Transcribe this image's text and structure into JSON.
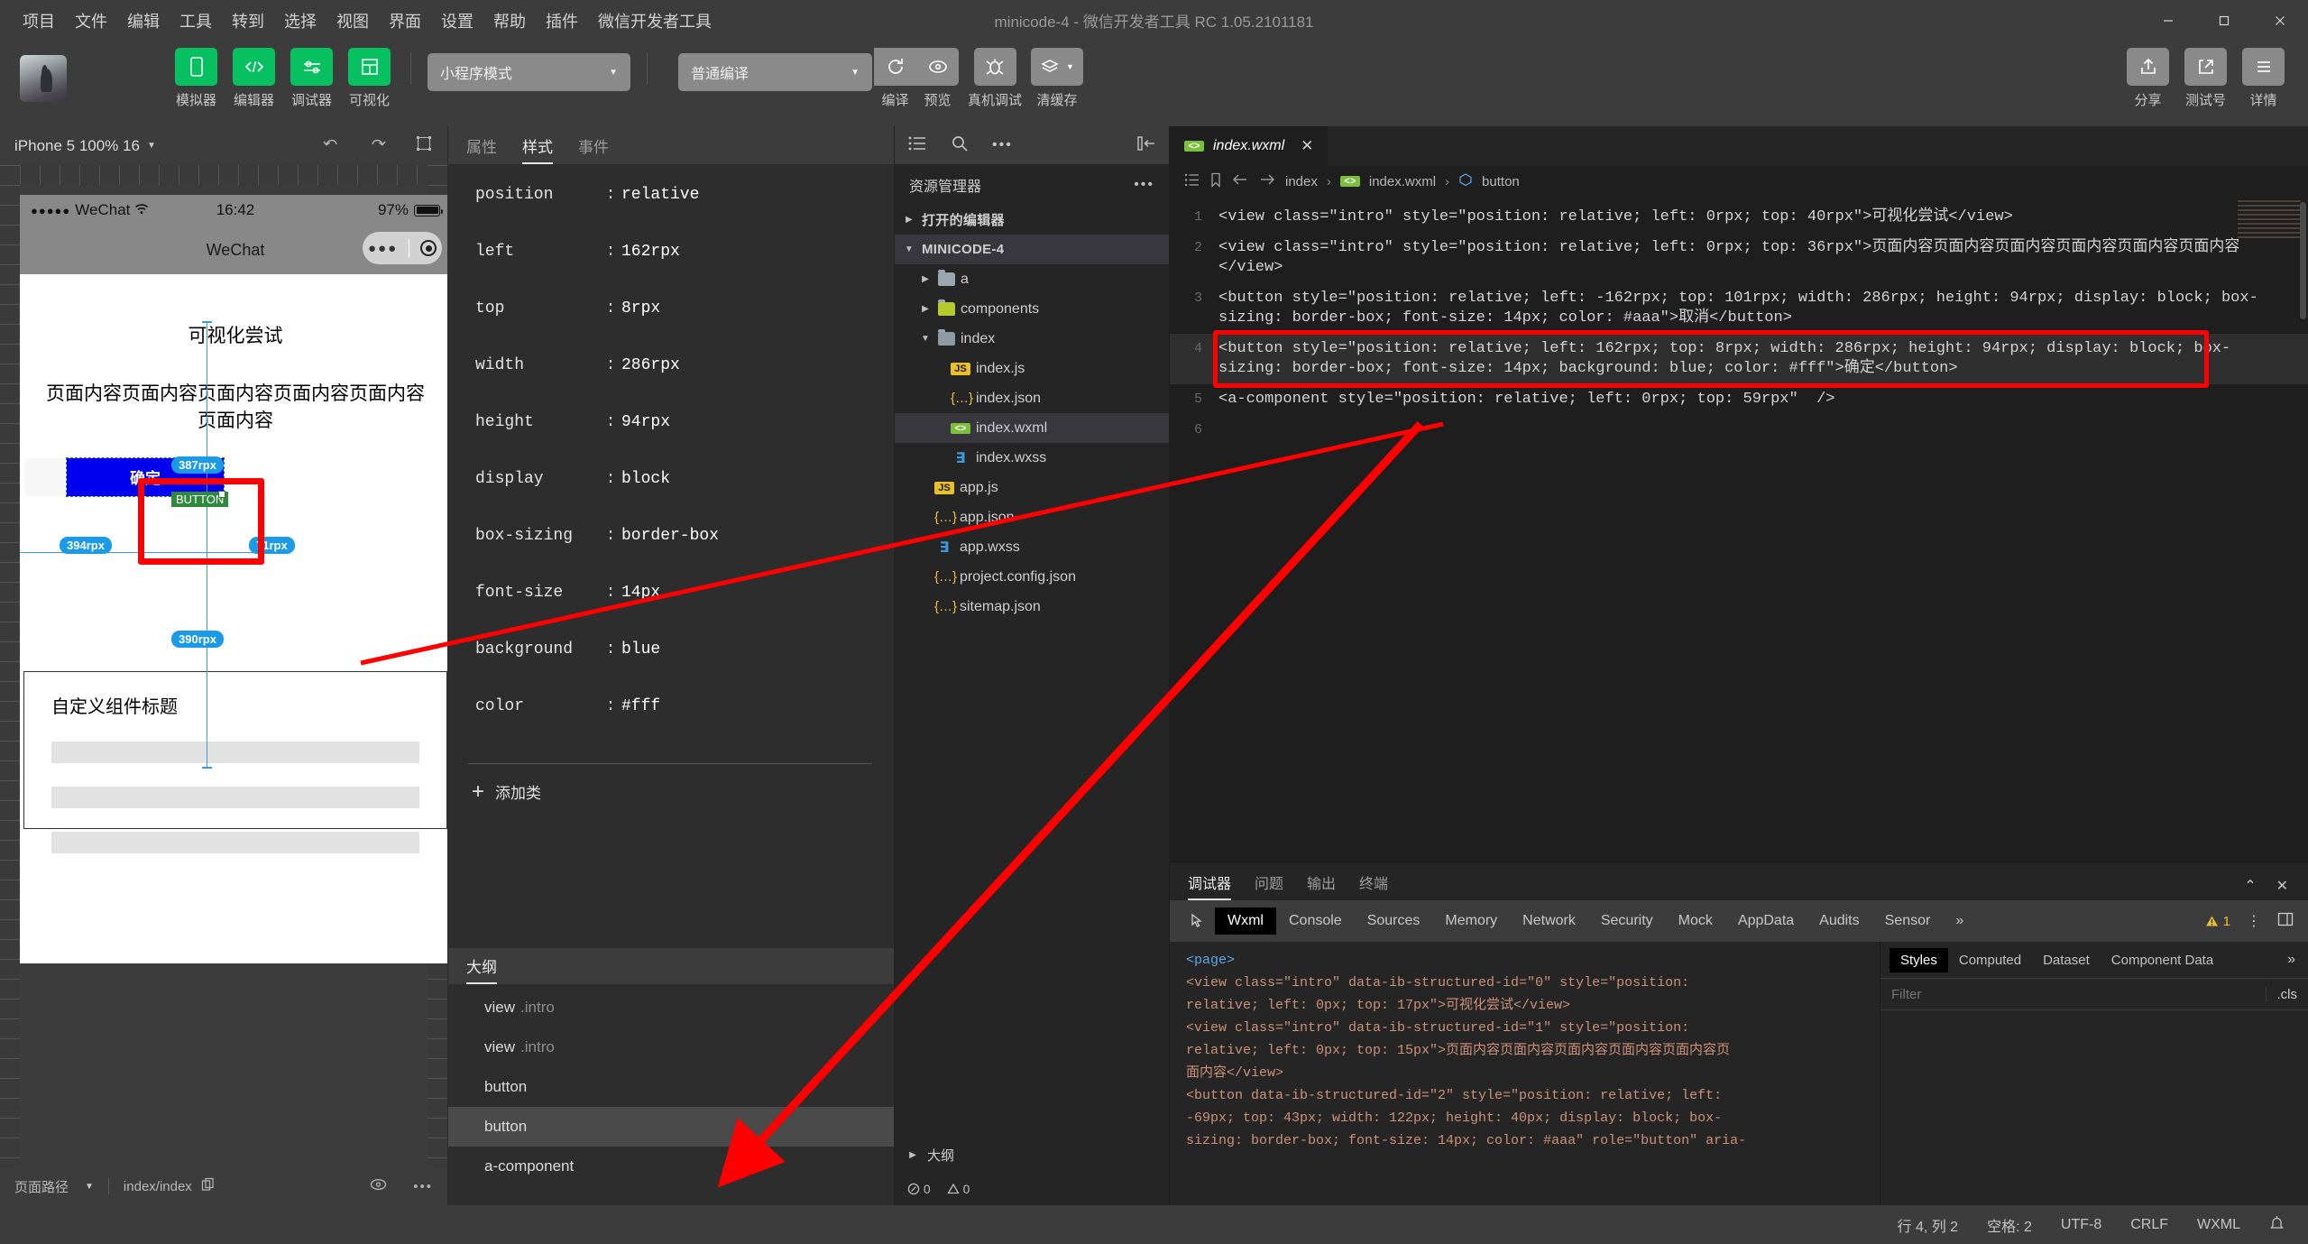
{
  "window": {
    "title": "minicode-4 - 微信开发者工具 RC 1.05.2101181",
    "menus": [
      "项目",
      "文件",
      "编辑",
      "工具",
      "转到",
      "选择",
      "视图",
      "界面",
      "设置",
      "帮助",
      "插件",
      "微信开发者工具"
    ]
  },
  "toolbar": {
    "left_items": [
      {
        "label": "模拟器",
        "icon": "phone-icon"
      },
      {
        "label": "编辑器",
        "icon": "code-icon"
      },
      {
        "label": "调试器",
        "icon": "debug-icon"
      },
      {
        "label": "可视化",
        "icon": "layout-icon"
      }
    ],
    "mode_select": "小程序模式",
    "compile_select": "普通编译",
    "actions": [
      {
        "label": "编译",
        "icon": "refresh-icon"
      },
      {
        "label": "预览",
        "icon": "eye-icon"
      },
      {
        "label": "真机调试",
        "icon": "bug-icon"
      },
      {
        "label": "清缓存",
        "icon": "layers-icon"
      }
    ],
    "right_items": [
      {
        "label": "分享",
        "icon": "share-icon"
      },
      {
        "label": "测试号",
        "icon": "external-link-icon"
      },
      {
        "label": "详情",
        "icon": "menu-icon"
      }
    ]
  },
  "simulator": {
    "device": "iPhone 5 100% 16",
    "status_bar": {
      "carrier": "WeChat",
      "time": "16:42",
      "battery": "97%",
      "dots": "●●●●●"
    },
    "nav_title": "WeChat",
    "page": {
      "intro1": "可视化尝试",
      "intro2": "页面内容页面内容页面内容页面内容页面内容页面内容",
      "cancel_button": "取消",
      "ok_button": "确定",
      "selected_tag": "BUTTON",
      "component_title": "自定义组件标题"
    },
    "badges": [
      "387rpx",
      "394rpx",
      "71rpx",
      "390rpx"
    ],
    "footer": {
      "path_label": "页面路径",
      "path_value": "index/index"
    }
  },
  "inspector": {
    "tabs": [
      {
        "label": "属性",
        "active": false
      },
      {
        "label": "样式",
        "active": true
      },
      {
        "label": "事件",
        "active": false
      }
    ],
    "styles": [
      {
        "prop": "position",
        "value": "relative"
      },
      {
        "prop": "left",
        "value": "162rpx"
      },
      {
        "prop": "top",
        "value": "8rpx"
      },
      {
        "prop": "width",
        "value": "286rpx"
      },
      {
        "prop": "height",
        "value": "94rpx"
      },
      {
        "prop": "display",
        "value": "block"
      },
      {
        "prop": "box-sizing",
        "value": "border-box"
      },
      {
        "prop": "font-size",
        "value": "14px"
      },
      {
        "prop": "background",
        "value": "blue"
      },
      {
        "prop": "color",
        "value": "#fff"
      }
    ],
    "add_class": "添加类",
    "outline_title": "大纲",
    "outline_items": [
      {
        "tag": "view",
        "cls": ".intro",
        "selected": false
      },
      {
        "tag": "view",
        "cls": ".intro",
        "selected": false
      },
      {
        "tag": "button",
        "cls": "",
        "selected": false
      },
      {
        "tag": "button",
        "cls": "",
        "selected": true
      },
      {
        "tag": "a-component",
        "cls": "",
        "selected": false
      }
    ]
  },
  "explorer": {
    "title": "资源管理器",
    "open_editors": "打开的编辑器",
    "project": "MINICODE-4",
    "tree": [
      {
        "name": "a",
        "type": "folder",
        "depth": 1,
        "open": false
      },
      {
        "name": "components",
        "type": "folder-comp",
        "depth": 1,
        "open": false
      },
      {
        "name": "index",
        "type": "folder-open",
        "depth": 1,
        "open": true
      },
      {
        "name": "index.js",
        "type": "js",
        "depth": 2
      },
      {
        "name": "index.json",
        "type": "json",
        "depth": 2
      },
      {
        "name": "index.wxml",
        "type": "wxml",
        "depth": 2,
        "selected": true
      },
      {
        "name": "index.wxss",
        "type": "wxss",
        "depth": 2
      },
      {
        "name": "app.js",
        "type": "js",
        "depth": 1
      },
      {
        "name": "app.json",
        "type": "json",
        "depth": 1
      },
      {
        "name": "app.wxss",
        "type": "wxss",
        "depth": 1
      },
      {
        "name": "project.config.json",
        "type": "json",
        "depth": 1
      },
      {
        "name": "sitemap.json",
        "type": "json",
        "depth": 1
      }
    ],
    "outline_label": "大纲",
    "status": {
      "errors": "0",
      "warnings": "0"
    }
  },
  "editor": {
    "tab": "index.wxml",
    "breadcrumb": [
      "index",
      "index.wxml",
      "button"
    ],
    "lines": [
      {
        "num": "1",
        "text": "<view class=\"intro\" style=\"position: relative; left: 0rpx; top: 40rpx\">可视化尝试</view>"
      },
      {
        "num": "2",
        "text": "<view class=\"intro\" style=\"position: relative; left: 0rpx; top: 36rpx\">页面内容页面内容页面内容页面内容页面内容页面内容</view>"
      },
      {
        "num": "3",
        "text": "<button style=\"position: relative; left: -162rpx; top: 101rpx; width: 286rpx; height: 94rpx; display: block; box-sizing: border-box; font-size: 14px; color: #aaa\">取消</button>"
      },
      {
        "num": "4",
        "text": "<button style=\"position: relative; left: 162rpx; top: 8rpx; width: 286rpx; height: 94rpx; display: block; box-sizing: border-box; font-size: 14px; background: blue; color: #fff\">确定</button>"
      },
      {
        "num": "5",
        "text": "<a-component style=\"position: relative; left: 0rpx; top: 59rpx\"  />"
      },
      {
        "num": "6",
        "text": ""
      }
    ]
  },
  "devtools": {
    "panel_tabs": [
      {
        "label": "调试器",
        "active": true
      },
      {
        "label": "问题",
        "active": false
      },
      {
        "label": "输出",
        "active": false
      },
      {
        "label": "终端",
        "active": false
      }
    ],
    "sub_tabs": [
      "Wxml",
      "Console",
      "Sources",
      "Memory",
      "Network",
      "Security",
      "Mock",
      "AppData",
      "Audits",
      "Sensor"
    ],
    "sub_tab_active": "Wxml",
    "more": "»",
    "warning_count": "1",
    "dom_lines": [
      "<page>",
      "  <view class=\"intro\" data-ib-structured-id=\"0\" style=\"position:",
      "  relative; left: 0px; top: 17px\">可视化尝试</view>",
      "  <view class=\"intro\" data-ib-structured-id=\"1\" style=\"position:",
      "  relative; left: 0px; top: 15px\">页面内容页面内容页面内容页面内容页面内容页",
      "  面内容</view>",
      "  <button data-ib-structured-id=\"2\" style=\"position: relative; left:",
      "  -69px; top: 43px; width: 122px; height: 40px; display: block; box-",
      "  sizing: border-box; font-size: 14px; color: #aaa\" role=\"button\" aria-"
    ],
    "styles_tabs": [
      {
        "label": "Styles",
        "active": true
      },
      {
        "label": "Computed",
        "active": false
      },
      {
        "label": "Dataset",
        "active": false
      },
      {
        "label": "Component Data",
        "active": false
      }
    ],
    "filter_placeholder": "Filter",
    "cls_label": ".cls"
  },
  "statusbar": {
    "cursor": "行 4, 列 2",
    "spaces": "空格: 2",
    "encoding": "UTF-8",
    "eol": "CRLF",
    "language": "WXML"
  }
}
